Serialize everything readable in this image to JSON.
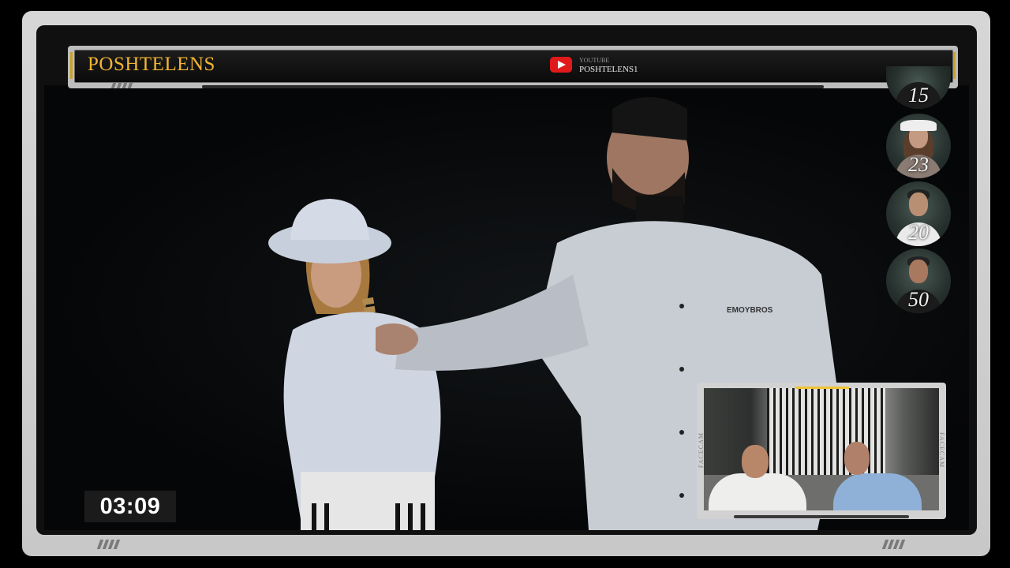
{
  "header": {
    "brand": "POSHTELENS",
    "platform_label": "YOUTUBE",
    "channel_name": "POSHTELENS1",
    "platform_icon": "youtube-icon",
    "accent_color": "#f2b431"
  },
  "rankings": [
    {
      "value": "15"
    },
    {
      "value": "23"
    },
    {
      "value": "20"
    },
    {
      "value": "50"
    }
  ],
  "timer": "03:09",
  "facecam": {
    "side_label": "FACECAM",
    "highlight_color": "#f1c232"
  },
  "stage": {
    "jacket_brand": "EMOYBROS"
  }
}
